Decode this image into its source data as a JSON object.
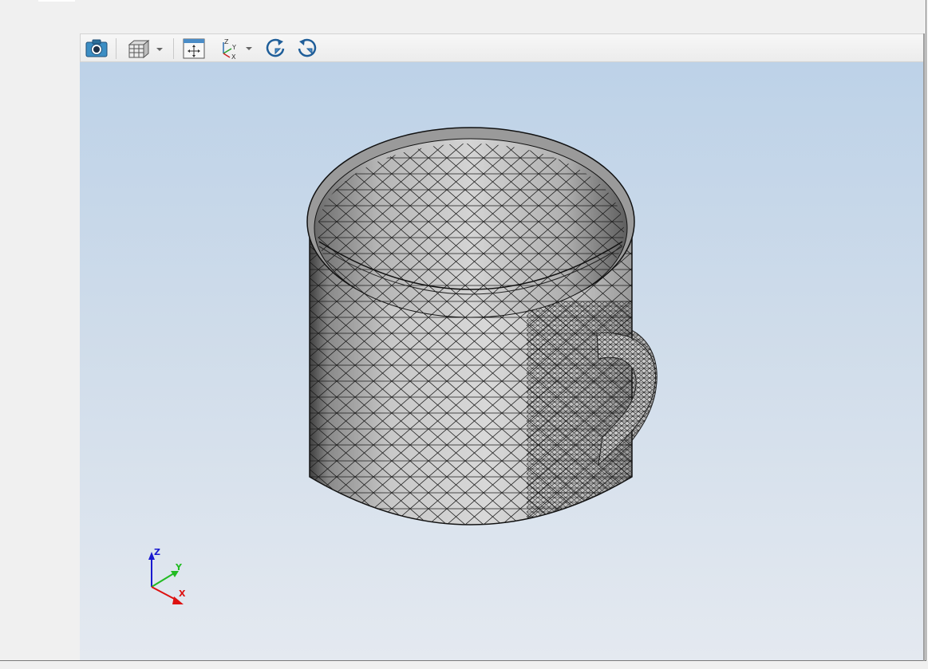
{
  "toolbar": {
    "buttons": [
      {
        "name": "screenshot-button",
        "icon": "camera-icon"
      },
      {
        "name": "view-style-button",
        "icon": "wireframe-cube-icon",
        "dropdown": true
      },
      {
        "name": "fit-all-button",
        "icon": "fit-view-icon"
      },
      {
        "name": "axes-view-button",
        "icon": "axes-icon",
        "dropdown": true
      },
      {
        "name": "rotate-left-button",
        "icon": "rotate-ccw-icon"
      },
      {
        "name": "rotate-right-button",
        "icon": "rotate-cw-icon"
      }
    ],
    "axes_icon_labels": {
      "z": "Z",
      "y": "Y",
      "x": "X"
    }
  },
  "viewport": {
    "model": "mesh-mug",
    "background_top": "#bdd2e8",
    "background_bottom": "#e4e9f0"
  },
  "triad": {
    "z_label": "Z",
    "y_label": "Y",
    "x_label": "X",
    "z_color": "#1a1ad0",
    "y_color": "#22bb22",
    "x_color": "#dd1111"
  }
}
